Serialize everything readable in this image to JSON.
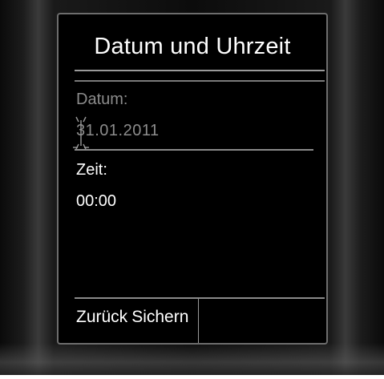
{
  "screen": {
    "title": "Datum und Uhrzeit",
    "fields": {
      "date_label": "Datum:",
      "date_value": "31.01.2011",
      "time_label": "Zeit:",
      "time_value": "00:00"
    },
    "softkeys": {
      "left": "Zurück",
      "right": "Sichern"
    }
  }
}
